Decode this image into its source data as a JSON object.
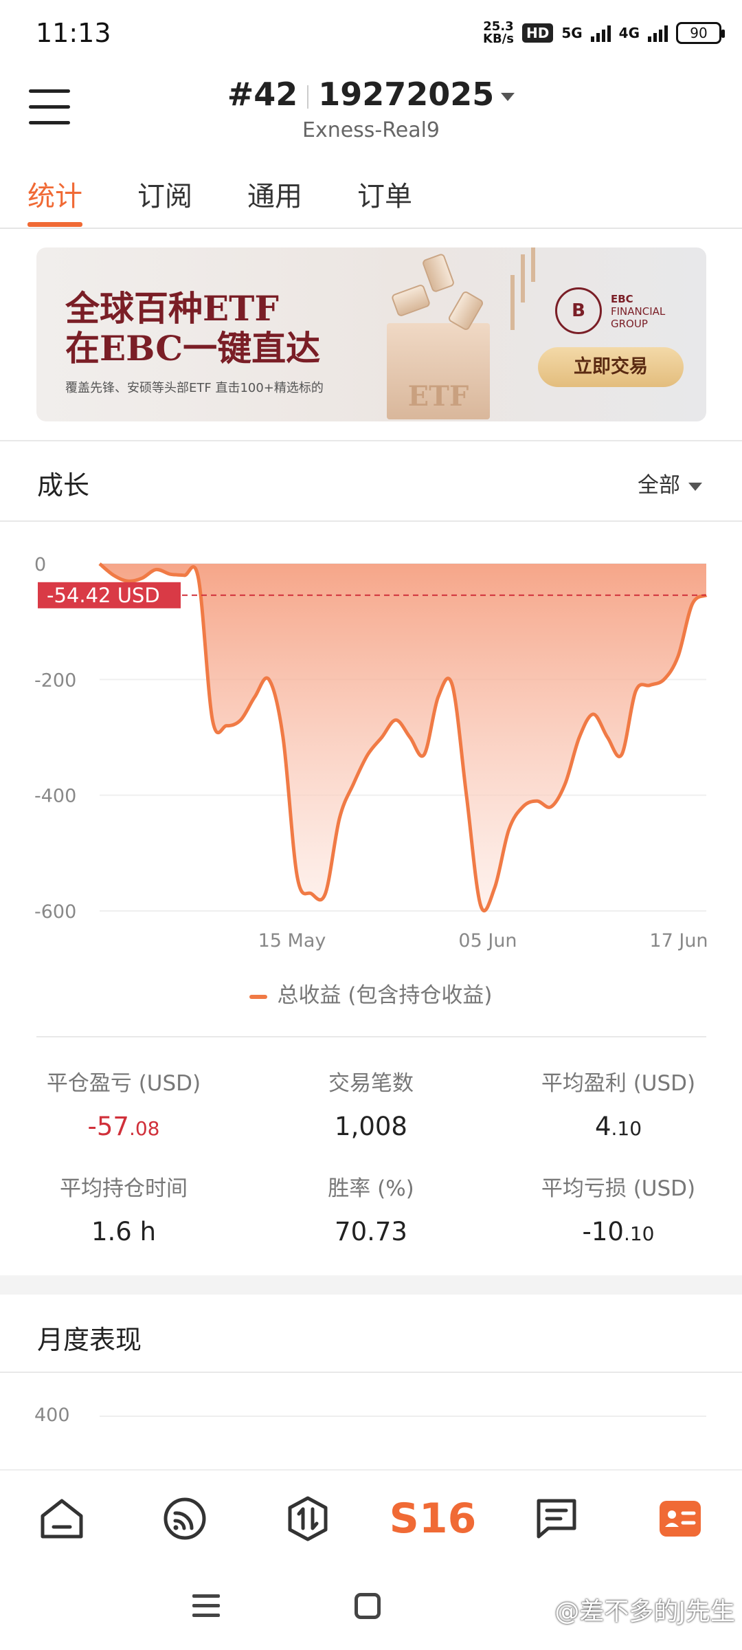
{
  "status_bar": {
    "time": "11:13",
    "net_speed_value": "25.3",
    "net_speed_unit": "KB/s",
    "hd_badge": "HD",
    "net_5g": "5G",
    "net_4g": "4G",
    "battery": "90"
  },
  "header": {
    "account_number": "#42",
    "account_id": "19272025",
    "server": "Exness-Real9"
  },
  "tabs": [
    {
      "label": "统计",
      "active": true
    },
    {
      "label": "订阅",
      "active": false
    },
    {
      "label": "通用",
      "active": false
    },
    {
      "label": "订单",
      "active": false
    }
  ],
  "banner": {
    "headline_1": "全球百种ETF",
    "headline_2": "在EBC一键直达",
    "subtext": "覆盖先锋、安硕等头部ETF 直击100+精选标的",
    "brand_line_1": "EBC",
    "brand_line_2": "FINANCIAL",
    "brand_line_3": "GROUP",
    "cta": "立即交易",
    "decor_text": "ETF"
  },
  "growth": {
    "title": "成长",
    "filter": "全部",
    "legend": "总收益 (包含持仓收益)",
    "current_label": "-54.42 USD"
  },
  "chart_data": {
    "type": "area",
    "title": "成长",
    "y_ticks": [
      "0",
      "-200",
      "-400",
      "-600"
    ],
    "x_ticks": [
      "15 May",
      "05 Jun",
      "17 Jun"
    ],
    "ylim": [
      -600,
      0
    ],
    "series": [
      {
        "name": "总收益 (包含持仓收益)",
        "values": [
          0,
          -20,
          -30,
          -25,
          -10,
          -18,
          -20,
          -25,
          -270,
          -280,
          -270,
          -230,
          -200,
          -300,
          -540,
          -570,
          -570,
          -440,
          -380,
          -330,
          -300,
          -270,
          -300,
          -330,
          -230,
          -210,
          -400,
          -590,
          -560,
          -460,
          -420,
          -410,
          -420,
          -380,
          -300,
          -260,
          -300,
          -330,
          -220,
          -210,
          -200,
          -160,
          -70,
          -54.42
        ]
      }
    ],
    "reference_line": -54.42,
    "grid": true
  },
  "stats": [
    {
      "label": "平仓盈亏 (USD)",
      "int": "-57",
      "dec": ".08",
      "negative": true
    },
    {
      "label": "交易笔数",
      "int": "1,008",
      "dec": "",
      "negative": false
    },
    {
      "label": "平均盈利 (USD)",
      "int": "4",
      "dec": ".10",
      "negative": false
    },
    {
      "label": "平均持仓时间",
      "int": "1.6 h",
      "dec": "",
      "negative": false
    },
    {
      "label": "胜率 (%)",
      "int": "70.73",
      "dec": "",
      "negative": false
    },
    {
      "label": "平均亏损 (USD)",
      "int": "-10",
      "dec": ".10",
      "negative": false
    }
  ],
  "monthly": {
    "title": "月度表现",
    "y_tick_top": "400"
  },
  "bottom_nav": {
    "s16_label": "S16"
  },
  "watermark": "@差不多的J先生",
  "colors": {
    "accent": "#f06a35",
    "negative": "#d0303a",
    "line": "#f07a45"
  }
}
